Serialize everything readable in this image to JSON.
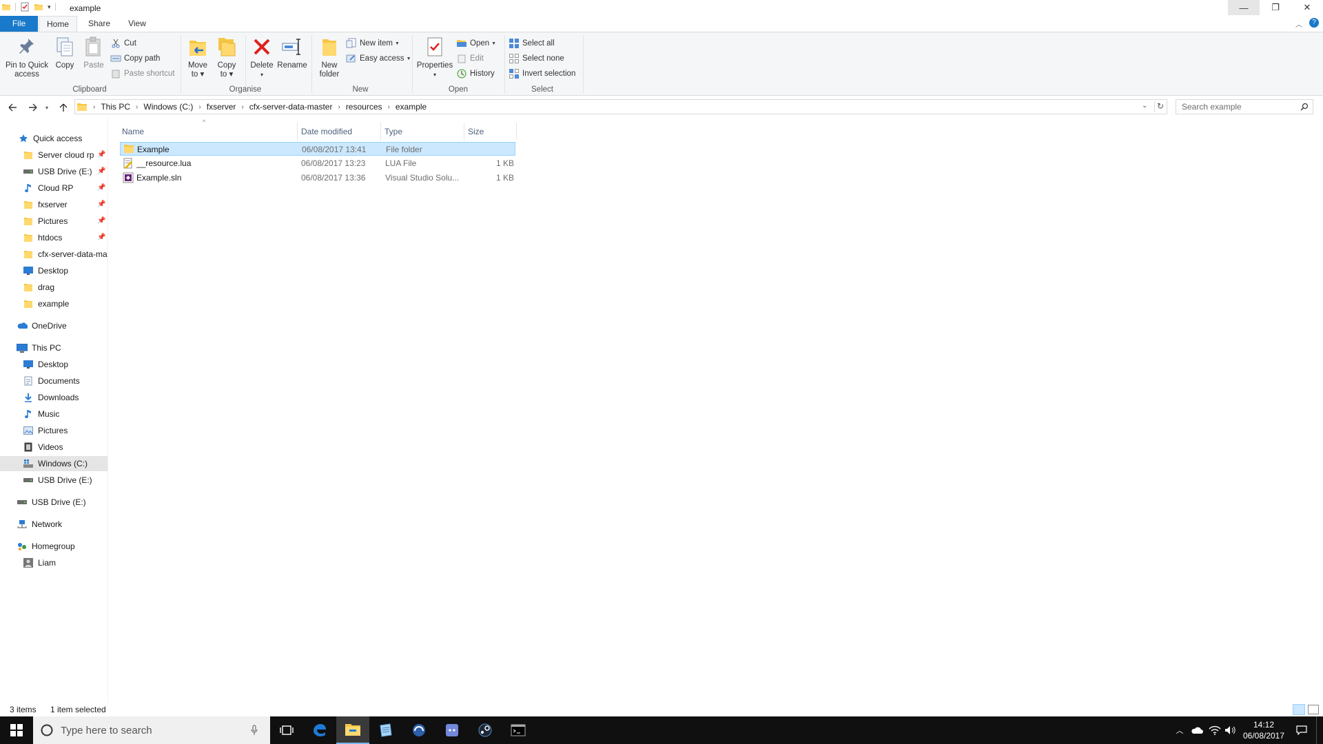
{
  "window": {
    "title": "example"
  },
  "window_controls": {
    "minimize": "—",
    "restore": "❐",
    "close": "✕"
  },
  "ribbon_tabs": [
    "File",
    "Home",
    "Share",
    "View"
  ],
  "ribbon": {
    "clipboard": {
      "label": "Clipboard",
      "pin": [
        "Pin to Quick",
        "access"
      ],
      "copy": "Copy",
      "paste": "Paste",
      "cut": "Cut",
      "copy_path": "Copy path",
      "paste_shortcut": "Paste shortcut"
    },
    "organise": {
      "label": "Organise",
      "move_to": [
        "Move",
        "to ▾"
      ],
      "copy_to": [
        "Copy",
        "to ▾"
      ],
      "delete": [
        "Delete",
        "▾"
      ],
      "rename": "Rename"
    },
    "new": {
      "label": "New",
      "new_folder": [
        "New",
        "folder"
      ],
      "new_item": "New item",
      "easy_access": "Easy access"
    },
    "open": {
      "label": "Open",
      "properties": [
        "Properties",
        "▾"
      ],
      "open": "Open",
      "edit": "Edit",
      "history": "History"
    },
    "select": {
      "label": "Select",
      "select_all": "Select all",
      "select_none": "Select none",
      "invert": "Invert selection"
    }
  },
  "address": {
    "crumbs": [
      "This PC",
      "Windows (C:)",
      "fxserver",
      "cfx-server-data-master",
      "resources",
      "example"
    ],
    "search_placeholder": "Search example"
  },
  "nav": {
    "quick_access": "Quick access",
    "quick_items": [
      {
        "label": "Server cloud rp",
        "icon": "folder-icon",
        "pinned": true
      },
      {
        "label": "USB Drive (E:)",
        "icon": "usb-drive-icon",
        "pinned": true
      },
      {
        "label": "Cloud RP",
        "icon": "music-note-icon",
        "pinned": true
      },
      {
        "label": "fxserver",
        "icon": "folder-icon",
        "pinned": true
      },
      {
        "label": "Pictures",
        "icon": "folder-icon",
        "pinned": true
      },
      {
        "label": "htdocs",
        "icon": "folder-icon",
        "pinned": true
      },
      {
        "label": "cfx-server-data-master",
        "icon": "folder-icon",
        "pinned": false
      },
      {
        "label": "Desktop",
        "icon": "desktop-icon",
        "pinned": false
      },
      {
        "label": "drag",
        "icon": "folder-icon",
        "pinned": false
      },
      {
        "label": "example",
        "icon": "folder-icon",
        "pinned": false
      }
    ],
    "onedrive": "OneDrive",
    "this_pc": "This PC",
    "pc_items": [
      {
        "label": "Desktop",
        "icon": "desktop-icon"
      },
      {
        "label": "Documents",
        "icon": "documents-icon"
      },
      {
        "label": "Downloads",
        "icon": "downloads-icon"
      },
      {
        "label": "Music",
        "icon": "music-icon"
      },
      {
        "label": "Pictures",
        "icon": "pictures-icon"
      },
      {
        "label": "Videos",
        "icon": "videos-icon"
      },
      {
        "label": "Windows (C:)",
        "icon": "windows-drive-icon",
        "selected": true
      },
      {
        "label": "USB Drive (E:)",
        "icon": "usb-drive-icon"
      }
    ],
    "usb": "USB Drive (E:)",
    "network": "Network",
    "homegroup": "Homegroup",
    "homegroup_user": "Liam"
  },
  "columns": [
    "Name",
    "Date modified",
    "Type",
    "Size"
  ],
  "files": [
    {
      "name": "Example",
      "date": "06/08/2017 13:41",
      "type": "File folder",
      "size": "",
      "icon": "folder-icon",
      "selected": true
    },
    {
      "name": "__resource.lua",
      "date": "06/08/2017 13:23",
      "type": "LUA File",
      "size": "1 KB",
      "icon": "lua-file-icon",
      "selected": false
    },
    {
      "name": "Example.sln",
      "date": "06/08/2017 13:36",
      "type": "Visual Studio Solu...",
      "size": "1 KB",
      "icon": "sln-file-icon",
      "selected": false
    }
  ],
  "status": {
    "count": "3 items",
    "selection": "1 item selected"
  },
  "taskbar": {
    "search_placeholder": "Type here to search",
    "clock_time": "14:12",
    "clock_date": "06/08/2017"
  },
  "colors": {
    "accent": "#1979ca",
    "selection": "#cce8ff",
    "folder": "#ffd86e",
    "taskbar": "#101010"
  }
}
